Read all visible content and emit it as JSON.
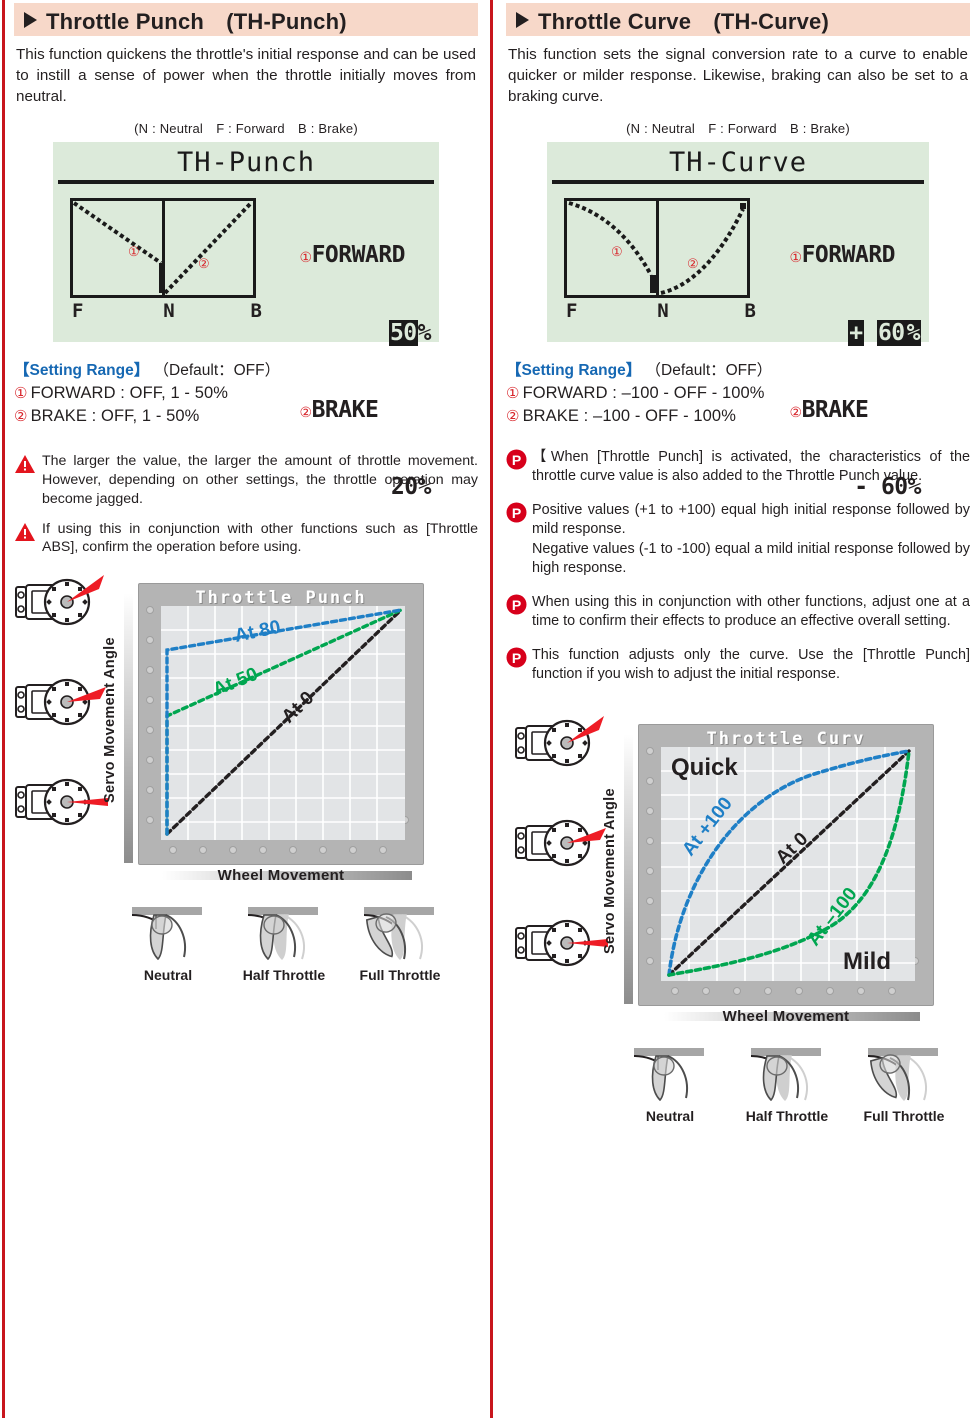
{
  "page": {
    "accent_red": "#c8161d",
    "header_bg": "#f7d8c9",
    "lcd_bg": "#dceada",
    "blue": "#1668b3",
    "green": "#00a650"
  },
  "left": {
    "header": {
      "title": "Throttle Punch　(TH-Punch)",
      "marker": "triangle-right"
    },
    "intro": "This function quickens the throttle's initial response and can be used to instill a sense of power when the throttle initially moves from neutral.",
    "legend": "(N : Neutral F : Forward B : Brake)",
    "lcd": {
      "title": "TH-Punch",
      "axis": {
        "f": "F",
        "n": "N",
        "b": "B"
      },
      "marker_1": "①",
      "marker_2": "②",
      "readout": {
        "line1_num": "①",
        "line1": "FORWARD",
        "value1": "50",
        "value1_suffix": "%",
        "line2_num": "②",
        "line2": "BRAKE",
        "value2": "20%"
      }
    },
    "setting": {
      "label": "【Setting Range】",
      "default": "（Default：OFF）",
      "lines": [
        {
          "num": "①",
          "text": "FORWARD : OFF, 1 - 50%"
        },
        {
          "num": "②",
          "text": "BRAKE : OFF, 1 - 50%"
        }
      ]
    },
    "notes": [
      {
        "icon": "warning-icon",
        "text": "The larger the value, the larger the amount of throttle movement. However, depending on other settings, the throttle operation may become jagged."
      },
      {
        "icon": "warning-icon",
        "text": "If using this in conjunction with other functions such as [Throttle ABS], confirm the operation before using."
      }
    ],
    "illustration": {
      "panel_title": "Throttle Punch",
      "y_label": "Servo Movement Angle",
      "x_label": "Wheel Movement",
      "curve_labels": [
        {
          "text": "At 80",
          "color": "#1f7fc6"
        },
        {
          "text": "At 50",
          "color": "#00a650"
        },
        {
          "text": "At 0",
          "color": "#231f20"
        }
      ]
    },
    "triggers": [
      {
        "label": "Neutral",
        "state": "neutral"
      },
      {
        "label": "Half Throttle",
        "state": "half"
      },
      {
        "label": "Full Throttle",
        "state": "full"
      }
    ]
  },
  "right": {
    "header": {
      "title": "Throttle Curve　(TH-Curve)",
      "marker": "triangle-right"
    },
    "intro": "This function sets the signal conversion rate to a curve to enable quicker or milder response. Likewise, braking can also be set to a braking curve.",
    "legend": "(N : Neutral F : Forward B : Brake)",
    "lcd": {
      "title": "TH-Curve",
      "axis": {
        "f": "F",
        "n": "N",
        "b": "B"
      },
      "marker_1": "①",
      "marker_2": "②",
      "readout": {
        "line1_num": "①",
        "line1": "FORWARD",
        "value1_sign": "+",
        "value1": "60",
        "value1_suffix": "%",
        "line2_num": "②",
        "line2": "BRAKE",
        "value2": "- 60%"
      }
    },
    "setting": {
      "label": "【Setting Range】",
      "default": "（Default：OFF）",
      "lines": [
        {
          "num": "①",
          "text": "FORWARD : –100 - OFF - 100%"
        },
        {
          "num": "②",
          "text": "BRAKE : –100 - OFF - 100%"
        }
      ]
    },
    "notes": [
      {
        "icon": "point-icon",
        "text": "【When [Throttle Punch] is activated, the characteristics of the throttle curve value is also added to the Throttle Punch value."
      },
      {
        "icon": "point-icon",
        "text": "Positive values (+1 to +100) equal high initial response followed by mild response.\nNegative values (-1 to -100) equal a mild initial response followed by high response."
      },
      {
        "icon": "point-icon",
        "text": "When using this in conjunction with other functions, adjust one at a time to confirm their effects to produce an effective overall setting."
      },
      {
        "icon": "point-icon",
        "text": "This function adjusts only the curve. Use the [Throttle Punch] function if you wish to adjust the initial response."
      }
    ],
    "illustration": {
      "panel_title": "Throttle Curv",
      "y_label": "Servo Movement Angle",
      "x_label": "Wheel Movement",
      "quick_label": "Quick",
      "mild_label": "Mild",
      "curve_labels": [
        {
          "text": "At +100",
          "color": "#1f7fc6"
        },
        {
          "text": "At 0",
          "color": "#231f20"
        },
        {
          "text": "At –100",
          "color": "#00a650"
        }
      ]
    },
    "triggers": [
      {
        "label": "Neutral",
        "state": "neutral"
      },
      {
        "label": "Half Throttle",
        "state": "half"
      },
      {
        "label": "Full Throttle",
        "state": "full"
      }
    ]
  },
  "chart_data": [
    {
      "type": "line",
      "title": "Throttle Punch",
      "xlabel": "Wheel Movement",
      "ylabel": "Servo Movement Angle",
      "xlim": [
        0,
        100
      ],
      "ylim": [
        0,
        100
      ],
      "grid": true,
      "legend": "inline-labels",
      "series": [
        {
          "name": "At 80",
          "color": "#1f7fc6",
          "x": [
            0,
            1,
            100
          ],
          "values": [
            0,
            80,
            100
          ]
        },
        {
          "name": "At 50",
          "color": "#00a650",
          "x": [
            0,
            1,
            100
          ],
          "values": [
            0,
            50,
            100
          ]
        },
        {
          "name": "At 0",
          "color": "#231f20",
          "x": [
            0,
            100
          ],
          "values": [
            0,
            100
          ]
        }
      ]
    },
    {
      "type": "line",
      "title": "Throttle Curv",
      "xlabel": "Wheel Movement",
      "ylabel": "Servo Movement Angle",
      "xlim": [
        0,
        100
      ],
      "ylim": [
        0,
        100
      ],
      "grid": true,
      "annotations": [
        "Quick",
        "Mild"
      ],
      "series": [
        {
          "name": "At +100",
          "color": "#1f7fc6",
          "x": [
            0,
            10,
            25,
            50,
            75,
            100
          ],
          "values": [
            0,
            32,
            58,
            80,
            93,
            100
          ]
        },
        {
          "name": "At 0",
          "color": "#231f20",
          "x": [
            0,
            100
          ],
          "values": [
            0,
            100
          ]
        },
        {
          "name": "At –100",
          "color": "#00a650",
          "x": [
            0,
            25,
            50,
            75,
            90,
            100
          ],
          "values": [
            0,
            7,
            20,
            42,
            68,
            100
          ]
        }
      ]
    }
  ]
}
